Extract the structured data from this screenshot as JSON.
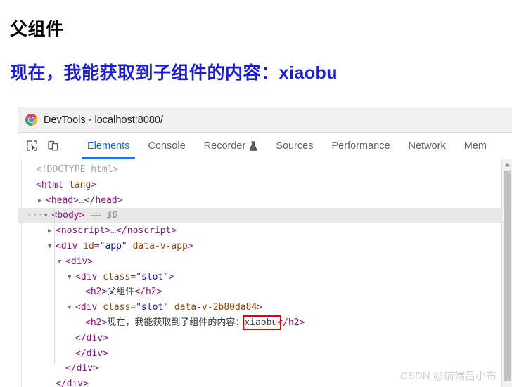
{
  "app_preview": {
    "parent_heading": "父组件",
    "child_heading": "现在，我能获取到子组件的内容：xiaobu",
    "child_heading_color": "#1a1ae6",
    "parent_heading_color": "#000000"
  },
  "devtools": {
    "titlebar": {
      "icon": "chrome-logo-icon",
      "title": "DevTools - localhost:8080/"
    },
    "toolbar_icons": [
      {
        "name": "inspect-element-icon",
        "tooltip": "Inspect element"
      },
      {
        "name": "device-toolbar-icon",
        "tooltip": "Toggle device toolbar"
      }
    ],
    "tabs": [
      {
        "label": "Elements",
        "active": true,
        "experimental": false
      },
      {
        "label": "Console",
        "active": false,
        "experimental": false
      },
      {
        "label": "Recorder",
        "active": false,
        "experimental": true
      },
      {
        "label": "Sources",
        "active": false,
        "experimental": false
      },
      {
        "label": "Performance",
        "active": false,
        "experimental": false
      },
      {
        "label": "Network",
        "active": false,
        "experimental": false
      },
      {
        "label": "Mem",
        "active": false,
        "experimental": false
      }
    ],
    "active_tab_color": "#1a73e8",
    "dom_tree": {
      "rows": [
        {
          "indent": 0,
          "twisty": "blank",
          "selected": false,
          "parts": [
            {
              "cls": "doct",
              "text": "<!DOCTYPE html>"
            }
          ]
        },
        {
          "indent": 0,
          "twisty": "blank",
          "selected": false,
          "parts": [
            {
              "cls": "tag",
              "text": "<html"
            },
            {
              "cls": "txt",
              "text": " "
            },
            {
              "cls": "attr",
              "text": "lang"
            },
            {
              "cls": "tag",
              "text": ">"
            }
          ]
        },
        {
          "indent": 1,
          "twisty": "closed",
          "selected": false,
          "parts": [
            {
              "cls": "tag",
              "text": "<head>"
            },
            {
              "cls": "ellip",
              "text": "…"
            },
            {
              "cls": "tag",
              "text": "</head>"
            }
          ]
        },
        {
          "indent": 1,
          "twisty": "open",
          "selected": true,
          "dots": true,
          "parts": [
            {
              "cls": "tag",
              "text": "<body>"
            },
            {
              "cls": "txt",
              "text": " "
            },
            {
              "cls": "dollr",
              "text": "== $0"
            }
          ]
        },
        {
          "indent": 2,
          "twisty": "closed",
          "selected": false,
          "parts": [
            {
              "cls": "tag",
              "text": "<noscript>"
            },
            {
              "cls": "ellip",
              "text": "…"
            },
            {
              "cls": "tag",
              "text": "</noscript>"
            }
          ]
        },
        {
          "indent": 2,
          "twisty": "open",
          "selected": false,
          "parts": [
            {
              "cls": "tag",
              "text": "<div"
            },
            {
              "cls": "txt",
              "text": " "
            },
            {
              "cls": "attr",
              "text": "id"
            },
            {
              "cls": "tag",
              "text": "="
            },
            {
              "cls": "val",
              "text": "\"app\""
            },
            {
              "cls": "txt",
              "text": " "
            },
            {
              "cls": "attr",
              "text": "data-v-app"
            },
            {
              "cls": "tag",
              "text": ">"
            }
          ]
        },
        {
          "indent": 3,
          "twisty": "open",
          "selected": false,
          "parts": [
            {
              "cls": "tag",
              "text": "<div>"
            }
          ]
        },
        {
          "indent": 4,
          "twisty": "open",
          "selected": false,
          "parts": [
            {
              "cls": "tag",
              "text": "<div"
            },
            {
              "cls": "txt",
              "text": " "
            },
            {
              "cls": "attr",
              "text": "class"
            },
            {
              "cls": "tag",
              "text": "="
            },
            {
              "cls": "val",
              "text": "\"slot\""
            },
            {
              "cls": "tag",
              "text": ">"
            }
          ]
        },
        {
          "indent": 5,
          "twisty": "blank",
          "selected": false,
          "parts": [
            {
              "cls": "tag",
              "text": "<h2>"
            },
            {
              "cls": "txt",
              "text": "父组件"
            },
            {
              "cls": "tag",
              "text": "</h2>"
            }
          ]
        },
        {
          "indent": 4,
          "twisty": "open",
          "selected": false,
          "parts": [
            {
              "cls": "tag",
              "text": "<div"
            },
            {
              "cls": "txt",
              "text": " "
            },
            {
              "cls": "attr",
              "text": "class"
            },
            {
              "cls": "tag",
              "text": "="
            },
            {
              "cls": "val",
              "text": "\"slot\""
            },
            {
              "cls": "txt",
              "text": " "
            },
            {
              "cls": "attr",
              "text": "data-v-2b80da84"
            },
            {
              "cls": "tag",
              "text": ">"
            }
          ]
        },
        {
          "indent": 5,
          "twisty": "blank",
          "selected": false,
          "parts": [
            {
              "cls": "tag",
              "text": "<h2>"
            },
            {
              "cls": "txt",
              "text": "现在，我能获取到子组件的内容：xiaobu"
            },
            {
              "cls": "tag",
              "text": "</h2>"
            }
          ]
        },
        {
          "indent": 4,
          "twisty": "blank",
          "selected": false,
          "parts": [
            {
              "cls": "tag",
              "text": "</div>"
            }
          ]
        },
        {
          "indent": 4,
          "twisty": "blank",
          "selected": false,
          "parts": [
            {
              "cls": "tag",
              "text": "</div>"
            }
          ]
        },
        {
          "indent": 3,
          "twisty": "blank",
          "selected": false,
          "parts": [
            {
              "cls": "tag",
              "text": "</div>"
            }
          ]
        },
        {
          "indent": 2,
          "twisty": "blank",
          "selected": false,
          "parts": [
            {
              "cls": "tag",
              "text": "</div>"
            }
          ]
        }
      ],
      "colors": {
        "tag": "#881280",
        "attribute_name": "#994500",
        "attribute_value": "#1a1aa6",
        "text": "#303942",
        "doctype": "#a5a5a5",
        "selected_row_bg": "#e8e8e8"
      }
    },
    "annotation": {
      "name": "highlight-box",
      "target_text": "xiaobu",
      "color": "#e60000"
    },
    "scrollbar": {
      "orientation": "vertical",
      "position": "top"
    }
  },
  "watermark": "CSDN @前端吕小布"
}
